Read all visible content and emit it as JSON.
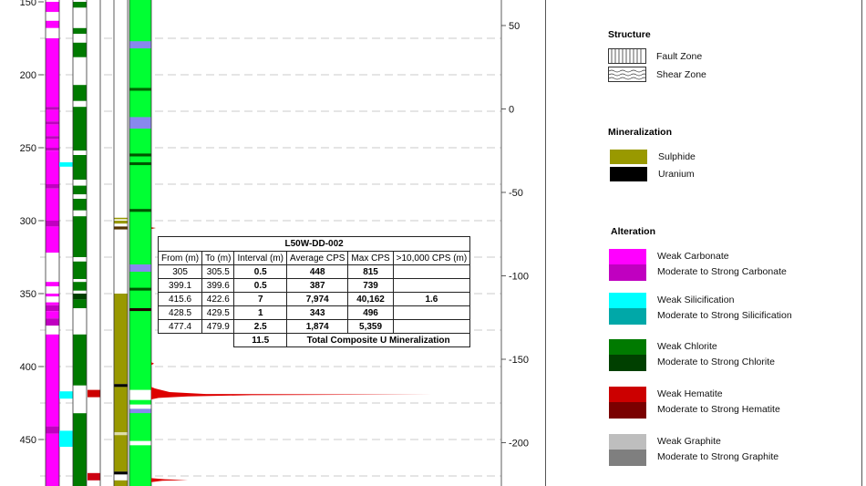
{
  "depth_axis": {
    "ticks": [
      "150",
      "200",
      "250",
      "300",
      "350",
      "400",
      "450"
    ]
  },
  "elevation_axis": {
    "ticks": [
      "50",
      "0",
      "-50",
      "-100",
      "-150",
      "-200"
    ]
  },
  "table": {
    "title": "L50W-DD-002",
    "headers": [
      "From (m)",
      "To (m)",
      "Interval (m)",
      "Average CPS",
      "Max CPS",
      ">10,000 CPS (m)"
    ],
    "rows": [
      [
        "305",
        "305.5",
        "0.5",
        "448",
        "815",
        ""
      ],
      [
        "399.1",
        "399.6",
        "0.5",
        "387",
        "739",
        ""
      ],
      [
        "415.6",
        "422.6",
        "7",
        "7,974",
        "40,162",
        "1.6"
      ],
      [
        "428.5",
        "429.5",
        "1",
        "343",
        "496",
        ""
      ],
      [
        "477.4",
        "479.9",
        "2.5",
        "1,874",
        "5,359",
        ""
      ]
    ],
    "total": {
      "interval": "11.5",
      "label": "Total Composite U Mineralization"
    }
  },
  "legend": {
    "structure": {
      "title": "Structure",
      "items": [
        "Fault Zone",
        "Shear Zone"
      ]
    },
    "mineralization": {
      "title": "Mineralization",
      "items": [
        {
          "label": "Sulphide",
          "color": "#999900"
        },
        {
          "label": "Uranium",
          "color": "#000000"
        }
      ]
    },
    "alteration": {
      "title": "Alteration",
      "groups": [
        {
          "weak": "Weak Carbonate",
          "strong": "Moderate to Strong Carbonate",
          "weak_color": "#ff00ff",
          "strong_color": "#c000c0"
        },
        {
          "weak": "Weak Silicification",
          "strong": "Moderate to Strong Silicification",
          "weak_color": "#00ffff",
          "strong_color": "#00a8a8"
        },
        {
          "weak": "Weak Chlorite",
          "strong": "Moderate to Strong Chlorite",
          "weak_color": "#007a00",
          "strong_color": "#004000"
        },
        {
          "weak": "Weak Hematite",
          "strong": "Moderate to Strong Hematite",
          "weak_color": "#cc0000",
          "strong_color": "#7a0000"
        },
        {
          "weak": "Weak Graphite",
          "strong": "Moderate to Strong Graphite",
          "weak_color": "#bebebe",
          "strong_color": "#7f7f7f"
        }
      ]
    }
  },
  "colors": {
    "carbonate_weak": "#ff00ff",
    "carbonate_strong": "#c000c0",
    "chlorite_weak": "#007a00",
    "chlorite_strong": "#004000",
    "silica_weak": "#00ffff",
    "hematite": "#cc0000",
    "sulphide": "#999900",
    "clay_green": "#00ff33",
    "lavender": "#8888ee",
    "radiometric": "#dd0000"
  }
}
